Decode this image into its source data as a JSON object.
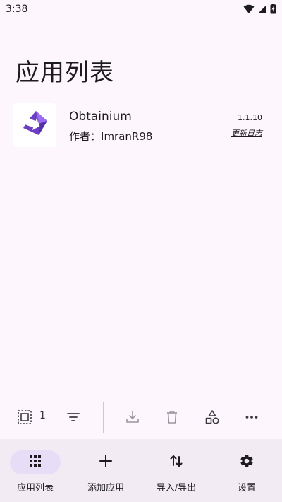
{
  "status_bar": {
    "time": "3:38",
    "icons": [
      "wifi-icon",
      "cell-signal-icon",
      "battery-charging-icon"
    ]
  },
  "header": {
    "title": "应用列表"
  },
  "apps": [
    {
      "name": "Obtainium",
      "author_prefix": "作者：",
      "author": "ImranR98",
      "version": "1.1.10",
      "changelog_label": "更新日志",
      "icon": "obtainium-logo"
    }
  ],
  "toolbar": {
    "select_all_icon": "select-all-icon",
    "selected_count": "1",
    "filter_icon": "filter-icon",
    "download_icon": "download-icon",
    "delete_icon": "delete-icon",
    "categories_icon": "shapes-icon",
    "more_icon": "more-horiz-icon"
  },
  "bottom_nav": {
    "items": [
      {
        "label": "应用列表",
        "icon": "apps-grid-icon",
        "active": true
      },
      {
        "label": "添加应用",
        "icon": "add-icon",
        "active": false
      },
      {
        "label": "导入/导出",
        "icon": "import-export-icon",
        "active": false
      },
      {
        "label": "设置",
        "icon": "settings-icon",
        "active": false
      }
    ]
  },
  "colors": {
    "background": "#fdf7fd",
    "nav_background": "#f2ebf4",
    "nav_active_pill": "#e8ddf6",
    "logo_purple": "#6b3fc4",
    "logo_purple_light": "#9a6cf0"
  }
}
